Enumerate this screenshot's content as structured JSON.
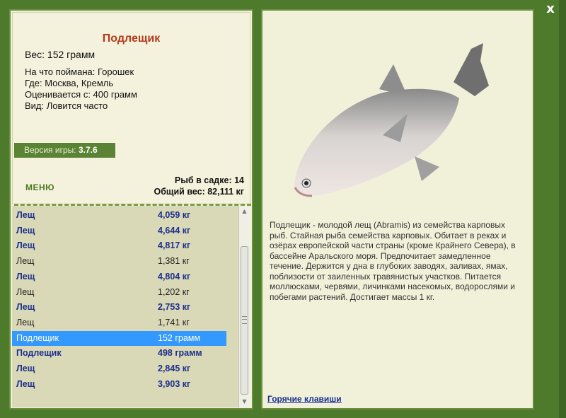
{
  "dialog": {
    "close_glyph": "x"
  },
  "fish_card": {
    "title": "Подлещик",
    "weight": "Вес: 152 грамм",
    "bait": "На что поймана: Горошек",
    "location": "Где: Москва, Кремль",
    "valuation": "Оценивается с: 400 грамм",
    "frequency": "Вид: Ловится часто"
  },
  "version": {
    "label": "Версия игры: ",
    "value": "3.7.6"
  },
  "menu": {
    "label": "МЕНЮ"
  },
  "keep_net": {
    "fish_count": "Рыб в садке: 14",
    "total_weight": "Общий вес: 82,111 кг"
  },
  "catch_list": [
    {
      "name": "Лещ",
      "weight": "4,059 кг",
      "style": "bold"
    },
    {
      "name": "Лещ",
      "weight": "4,644 кг",
      "style": "bold"
    },
    {
      "name": "Лещ",
      "weight": "4,817 кг",
      "style": "bold"
    },
    {
      "name": "Лещ",
      "weight": "1,381 кг",
      "style": "plain"
    },
    {
      "name": "Лещ",
      "weight": "4,804 кг",
      "style": "bold"
    },
    {
      "name": "Лещ",
      "weight": "1,202 кг",
      "style": "plain"
    },
    {
      "name": "Лещ",
      "weight": "2,753 кг",
      "style": "bold"
    },
    {
      "name": "Лещ",
      "weight": "1,741 кг",
      "style": "plain"
    },
    {
      "name": "Подлещик",
      "weight": "152 грамм",
      "style": "selected"
    },
    {
      "name": "Подлещик",
      "weight": "498 грамм",
      "style": "bold"
    },
    {
      "name": "Лещ",
      "weight": "2,845 кг",
      "style": "bold"
    },
    {
      "name": "Лещ",
      "weight": "3,903 кг",
      "style": "bold"
    }
  ],
  "description": "Подлещик - молодой лещ (Abramis) из семейства карповых рыб. Стайная рыба семейства карповых. Обитает в реках и озёрах европейской части страны (кроме Крайнего Севера), в бассейне Аральского моря. Предпочитает замедленное течение. Держится у дна в глубоких заводях, заливах, ямах, поблизости от заиленных травянистых участков. Питается моллюсками, червями, личинками насекомых, водорослями и побегами растений. Достигает массы 1 кг.",
  "hotkeys": {
    "label": "Горячие клавиши"
  },
  "colors": {
    "frame_green": "#4d7a2b",
    "panel_bg": "#f1f0d9",
    "title_red": "#b5391c",
    "selection_blue": "#3399ff",
    "list_bold_text": "#1c2f8c"
  },
  "icons": {
    "close": "close-icon",
    "fish_picture": "fish-illustration"
  }
}
